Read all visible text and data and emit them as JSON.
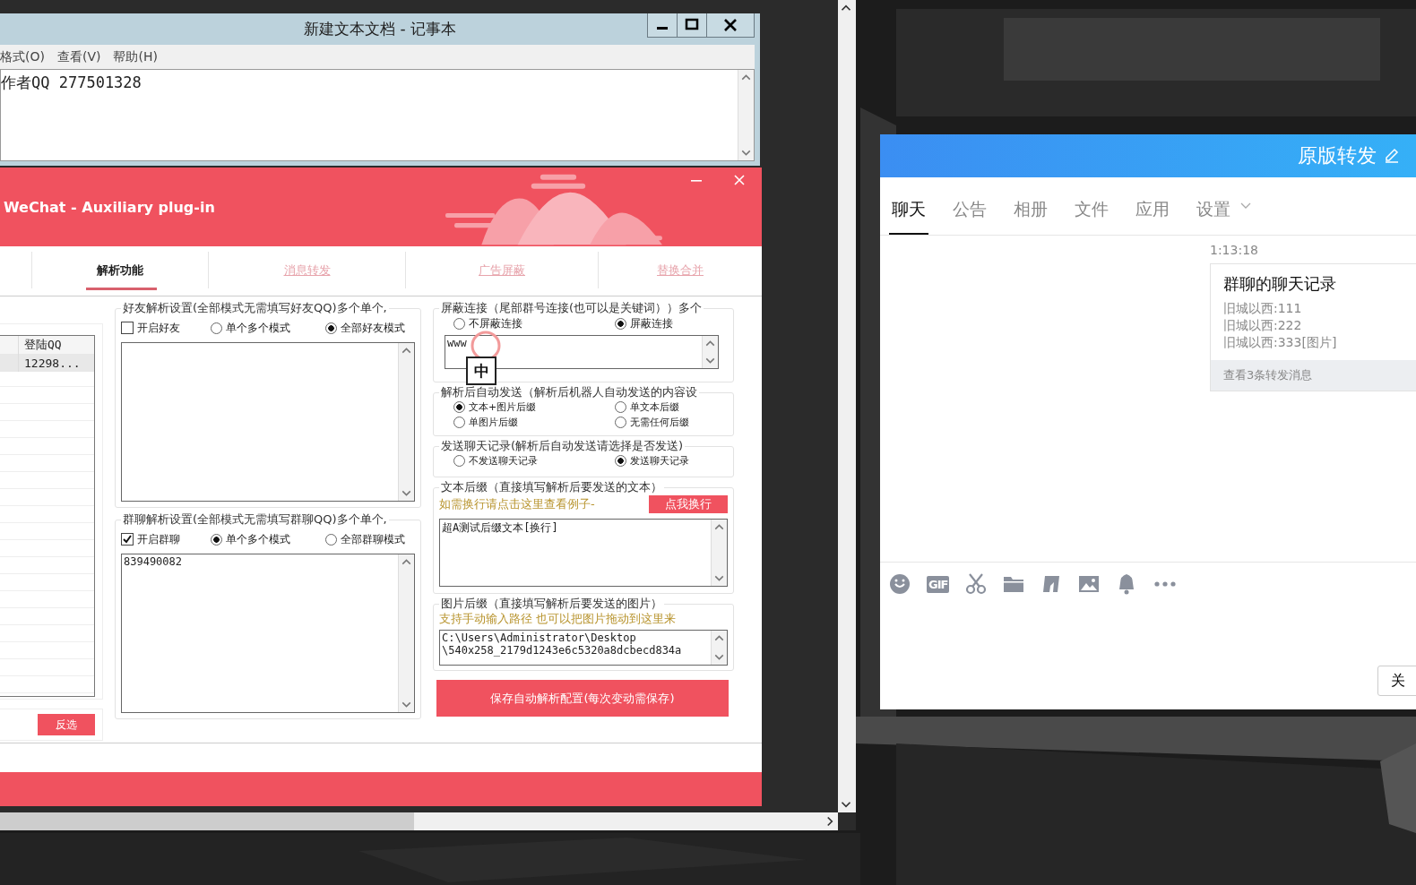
{
  "notepad": {
    "title": "新建文本文档 - 记事本",
    "menu": [
      "格式(O)",
      "查看(V)",
      "帮助(H)"
    ],
    "text": "作者QQ 277501328"
  },
  "plugin": {
    "title": "WeChat - Auxiliary plug-in",
    "tabs": [
      {
        "label": "解析功能",
        "selected": true
      },
      {
        "label": "消息转发",
        "selected": false
      },
      {
        "label": "广告屏蔽",
        "selected": false
      },
      {
        "label": "替换合并",
        "selected": false
      }
    ],
    "accounts": {
      "column": "登陆QQ",
      "rows": [
        {
          "qq": "12298...",
          "selected": true
        }
      ]
    },
    "invert_button": "反选",
    "friend_group": {
      "title": "好友解析设置(全部模式无需填写好友QQ)多个单个,",
      "enable": {
        "label": "开启好友",
        "checked": false
      },
      "modes": [
        {
          "label": "单个多个模式",
          "selected": false
        },
        {
          "label": "全部好友模式",
          "selected": true
        }
      ]
    },
    "group_group": {
      "title": "群聊解析设置(全部模式无需填写群聊QQ)多个单个,",
      "enable": {
        "label": "开启群聊",
        "checked": true
      },
      "modes": [
        {
          "label": "单个多个模式",
          "selected": true
        },
        {
          "label": "全部群聊模式",
          "selected": false
        }
      ],
      "value": "839490082"
    },
    "block": {
      "title": "屏蔽连接（尾部群号连接(也可以是关键词））多个",
      "options": [
        {
          "label": "不屏蔽连接",
          "selected": false
        },
        {
          "label": "屏蔽连接",
          "selected": true
        }
      ],
      "value": "www",
      "ime": "中"
    },
    "auto_send": {
      "title": "解析后自动发送（解析后机器人自动发送的内容设",
      "options": [
        {
          "label": "文本+图片后缀",
          "selected": true
        },
        {
          "label": "单文本后缀",
          "selected": false
        },
        {
          "label": "单图片后缀",
          "selected": false
        },
        {
          "label": "无需任何后缀",
          "selected": false
        }
      ]
    },
    "send_record": {
      "title": "发送聊天记录(解析后自动发送请选择是否发送)",
      "options": [
        {
          "label": "不发送聊天记录",
          "selected": false
        },
        {
          "label": "发送聊天记录",
          "selected": true
        }
      ]
    },
    "text_suffix": {
      "title": "文本后缀（直接填写解析后要发送的文本）",
      "hint": "如需换行请点击这里查看例子-",
      "button": "点我换行",
      "value": "超A测试后缀文本[换行]"
    },
    "image_suffix": {
      "title": "图片后缀（直接填写解析后要发送的图片）",
      "hint": "支持手动输入路径 也可以把图片拖动到这里来",
      "value": "C:\\Users\\Administrator\\Desktop\n\\540x258_2179d1243e6c5320a8dcbecd834a"
    },
    "save_button": "保存自动解析配置(每次变动需保存)"
  },
  "chat": {
    "title": "原版转发",
    "tabs": [
      {
        "label": "聊天",
        "selected": true
      },
      {
        "label": "公告",
        "selected": false
      },
      {
        "label": "相册",
        "selected": false
      },
      {
        "label": "文件",
        "selected": false
      },
      {
        "label": "应用",
        "selected": false
      },
      {
        "label": "设置",
        "selected": false
      }
    ],
    "time": "1:13:18",
    "card": {
      "title": "群聊的聊天记录",
      "lines": [
        "旧城以西:111",
        "旧城以西:222",
        "旧城以西:333[图片]"
      ],
      "footer": "查看3条转发消息"
    },
    "gif": "GIF",
    "close_button": "关"
  }
}
